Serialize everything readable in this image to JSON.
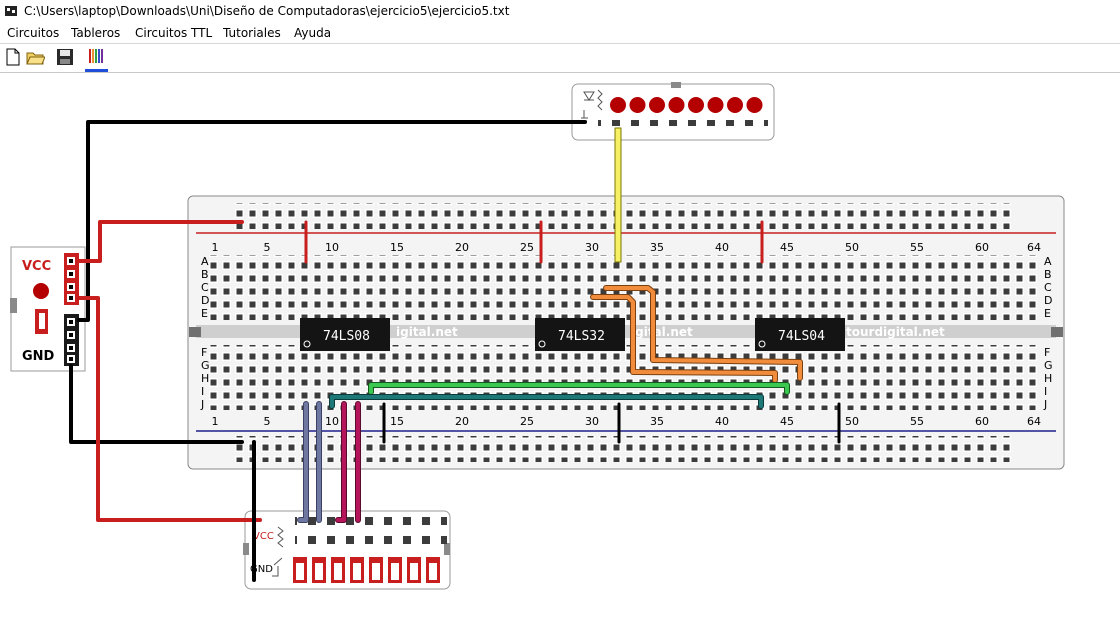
{
  "window": {
    "title": "C:\\Users\\laptop\\Downloads\\Uni\\Diseño de Computadoras\\ejercicio5\\ejercicio5.txt"
  },
  "menu": [
    {
      "label": "Circuitos"
    },
    {
      "label": "Tableros"
    },
    {
      "label": "Circuitos TTL"
    },
    {
      "label": "Tutoriales"
    },
    {
      "label": "Ayuda"
    }
  ],
  "toolbar": {
    "buttons": [
      {
        "icon": "new-file-icon"
      },
      {
        "icon": "open-folder-icon"
      },
      {
        "icon": "save-icon"
      },
      {
        "icon": "wire-colors-icon",
        "active": true
      }
    ]
  },
  "power_source": {
    "vcc_label": "VCC",
    "gnd_label": "GND"
  },
  "breadboard": {
    "column_numbers": [
      "1",
      "5",
      "10",
      "15",
      "20",
      "25",
      "30",
      "35",
      "40",
      "45",
      "50",
      "55",
      "60",
      "64"
    ],
    "upper_row_letters": [
      "A",
      "B",
      "C",
      "D",
      "E"
    ],
    "lower_row_letters": [
      "F",
      "G",
      "H",
      "I",
      "J"
    ],
    "watermark_texts": [
      "igital.net",
      "igital.net",
      "tourdigital.net"
    ],
    "chips": [
      {
        "label": "74LS08"
      },
      {
        "label": "74LS32"
      },
      {
        "label": "74LS04"
      }
    ]
  },
  "switch_board": {
    "vcc_label": "VCC",
    "gnd_label": "GND",
    "switch_count": 8
  },
  "led_board": {
    "led_count": 8
  },
  "colors": {
    "wire_red": "#c8141e",
    "wire_black": "#000000",
    "wire_yellow": "#f5f064",
    "wire_orange": "#f08c3c",
    "wire_green": "#3cc850",
    "wire_teal": "#1e7878",
    "wire_slate": "#6e78a0",
    "wire_magenta": "#b4145a",
    "led_red": "#b40000",
    "rail_red": "#c81e1e",
    "rail_blue": "#1e1e8c"
  }
}
